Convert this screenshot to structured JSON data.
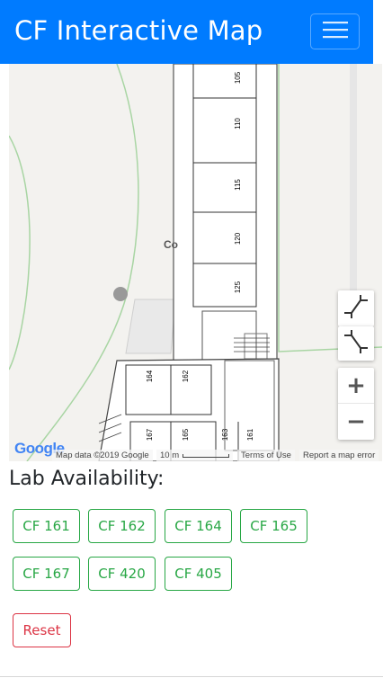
{
  "app": {
    "title": "CF Interactive Map"
  },
  "navbar": {
    "toggle_icon": "hamburger-icon"
  },
  "map": {
    "rooms": [
      "105",
      "110",
      "115",
      "120",
      "125",
      "164",
      "162",
      "167",
      "165",
      "163",
      "161"
    ],
    "partial_label": "Co",
    "logo": "Google",
    "attribution": "Map data ©2019 Google",
    "scale_label": "10 m",
    "terms": "Terms of Use",
    "report": "Report a map error",
    "controls": {
      "exit_fullscreen_icon": "exit-fullscreen-icon",
      "zoom_in": "+",
      "zoom_out": "−"
    }
  },
  "availability": {
    "heading": "Lab Availability:",
    "labs": [
      "CF 161",
      "CF 162",
      "CF 164",
      "CF 165",
      "CF 167",
      "CF 420",
      "CF 405"
    ],
    "reset_label": "Reset",
    "colors": {
      "available": "#28a745",
      "reset": "#dc3545"
    }
  }
}
